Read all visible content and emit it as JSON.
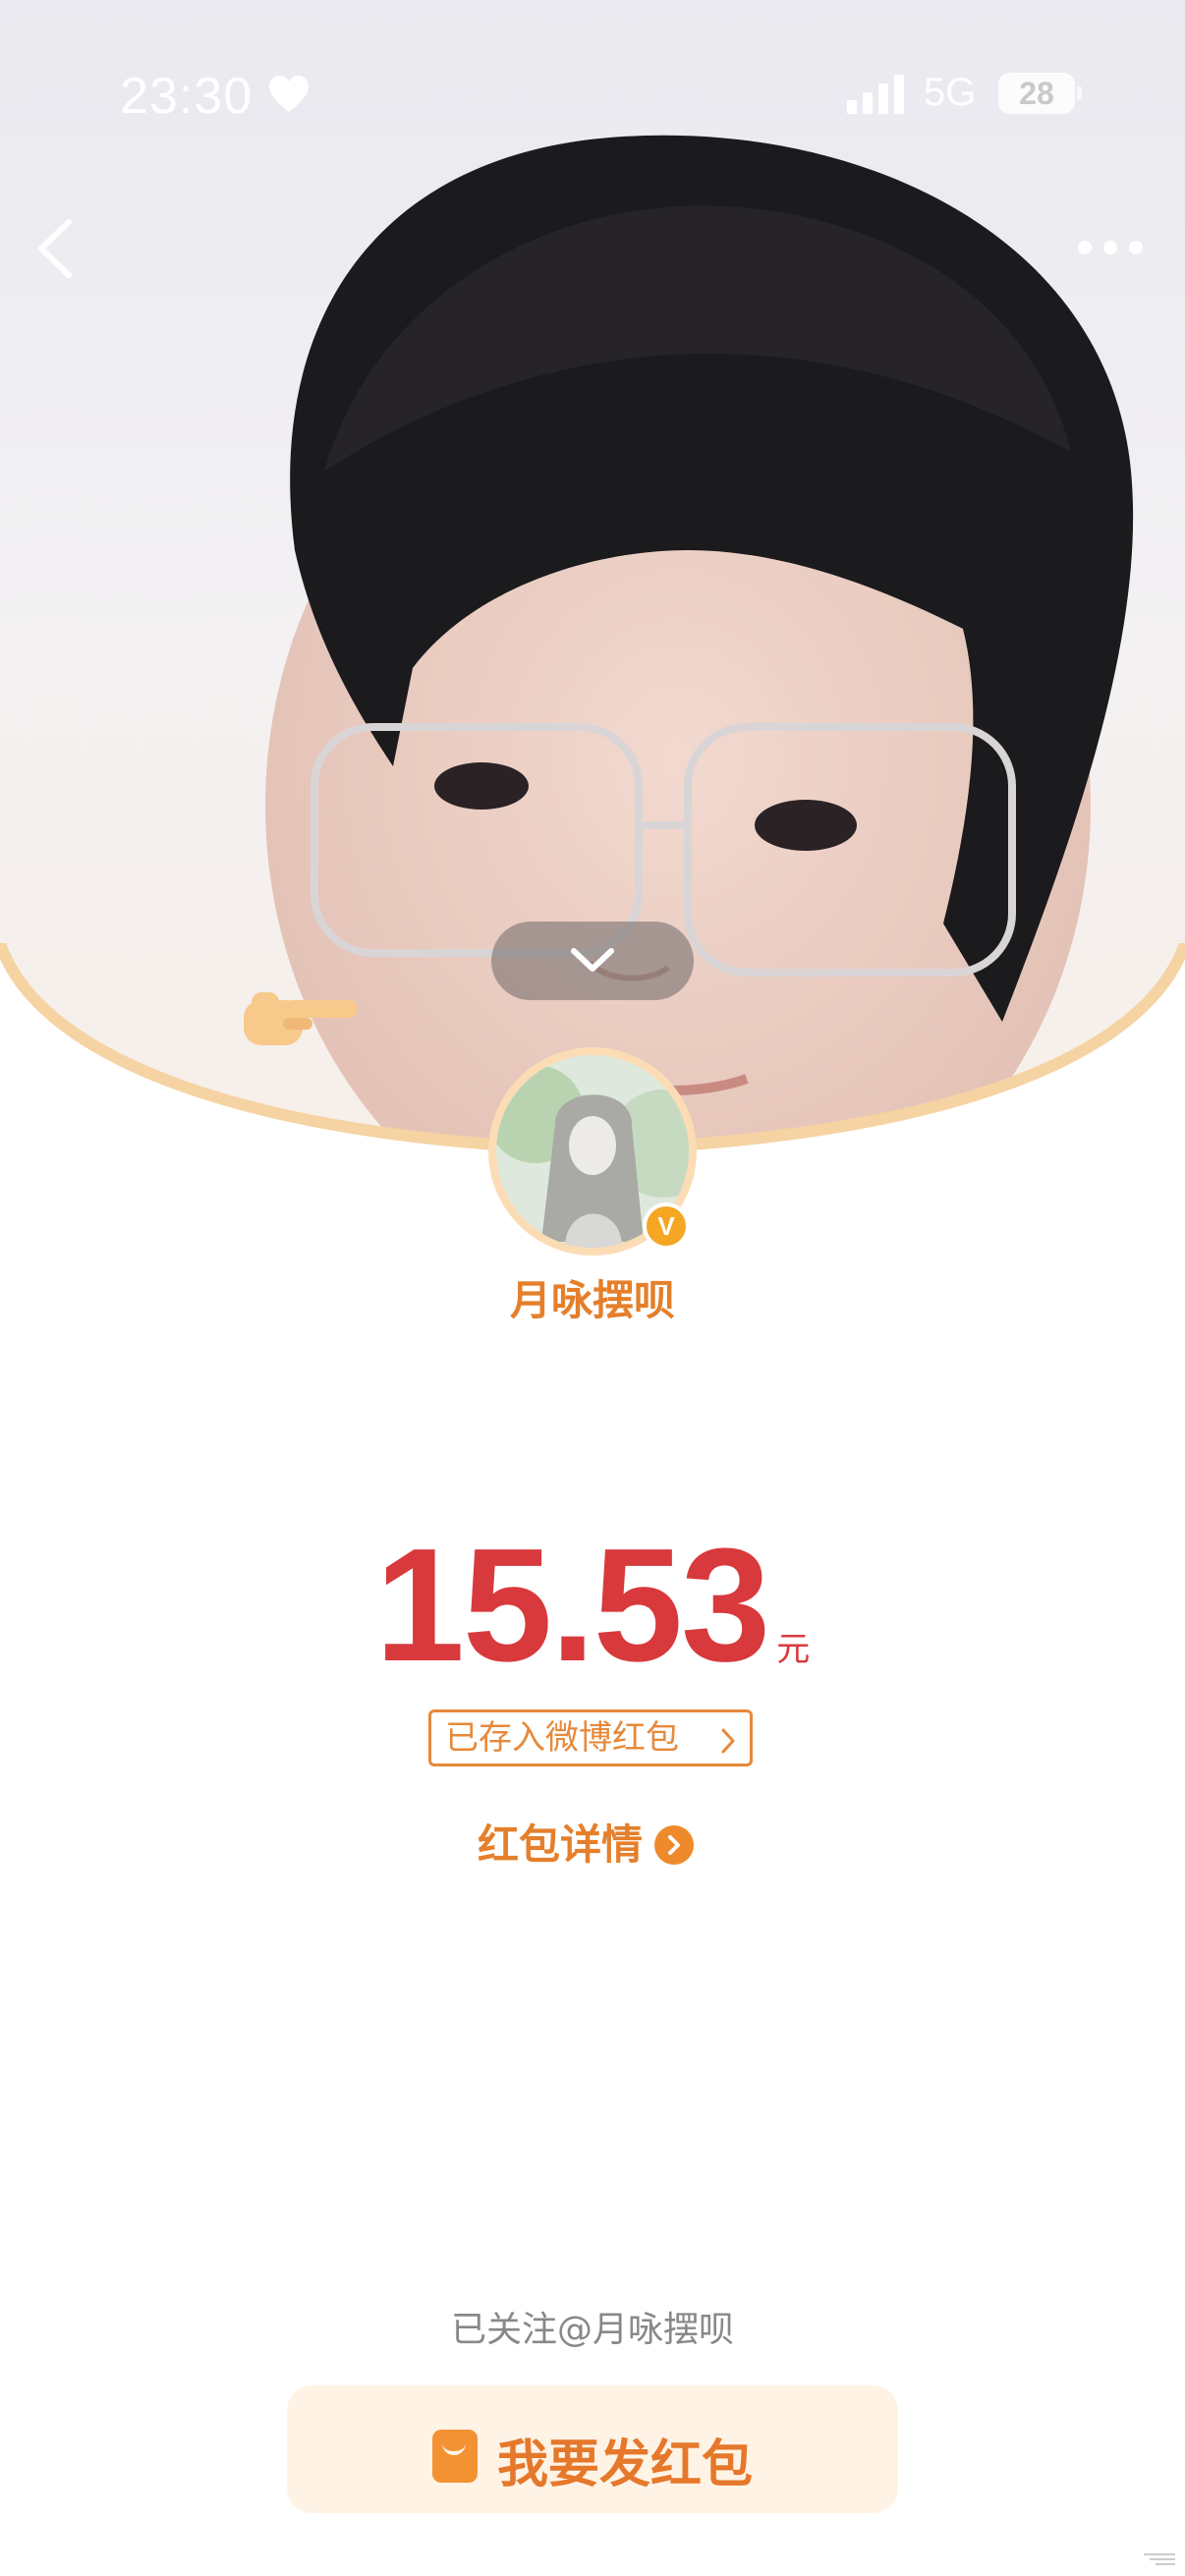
{
  "status_bar": {
    "time": "23:30",
    "network": "5G",
    "battery": "28",
    "icons": [
      "heart-icon",
      "signal-bars-icon",
      "battery-icon"
    ]
  },
  "nav": {
    "back_icon": "chevron-left-icon",
    "more_icon": "ellipsis-icon"
  },
  "cover": {
    "collapse_icon": "chevron-down-icon",
    "emoji": "pointing-hand-emoji"
  },
  "sender": {
    "name": "月咏摆呗",
    "badge": "V"
  },
  "red_packet": {
    "amount": "15.53",
    "currency": "元",
    "saved_link": "已存入微博红包",
    "details_link": "红包详情"
  },
  "footer": {
    "followed_text": "已关注@月咏摆呗",
    "send_button": "我要发红包"
  },
  "colors": {
    "accent_orange": "#e57f2b",
    "amount_red": "#d8393c",
    "button_bg": "#fff3e6",
    "curve_gold": "#f6d3a3"
  }
}
